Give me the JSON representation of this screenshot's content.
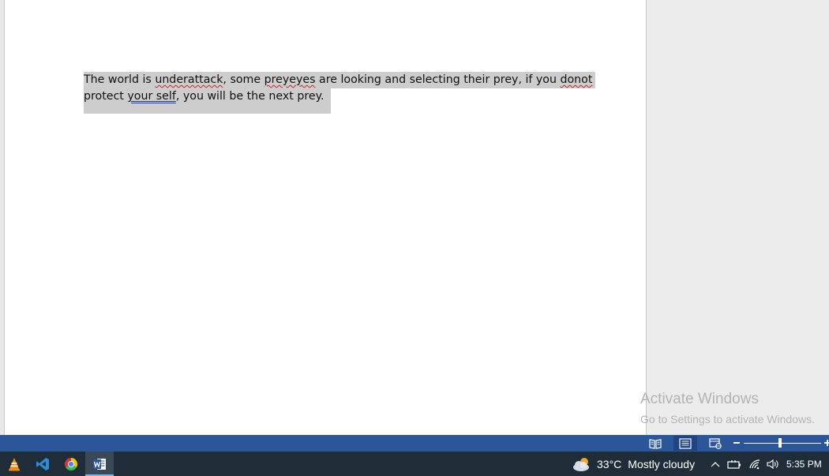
{
  "document": {
    "line1": {
      "part1": "The world is ",
      "err1": "underattack",
      "part2": ", some ",
      "err2": "preyeyes",
      "part3": " are looking and selecting their prey, if you ",
      "err3": "donot"
    },
    "line2": {
      "part1": "protect ",
      "err1": "your self",
      "part2": ", you will be the next prey."
    }
  },
  "watermark": {
    "title": "Activate Windows",
    "subtitle": "Go to Settings to activate Windows."
  },
  "status_bar": {
    "views": [
      "read-mode-icon",
      "print-layout-icon",
      "web-layout-icon"
    ],
    "active_view": "print-layout",
    "zoom_level": 0.47
  },
  "taskbar": {
    "apps": [
      "vlc-icon",
      "vscode-icon",
      "chrome-icon",
      "word-icon"
    ],
    "active_app": "word",
    "weather": {
      "temp": "33°C",
      "desc": "Mostly cloudy"
    },
    "clock": "5:35 PM"
  },
  "colors": {
    "status_bar": "#2b579a",
    "taskbar": "#1f2d38",
    "selection": "#cdcdcd"
  }
}
